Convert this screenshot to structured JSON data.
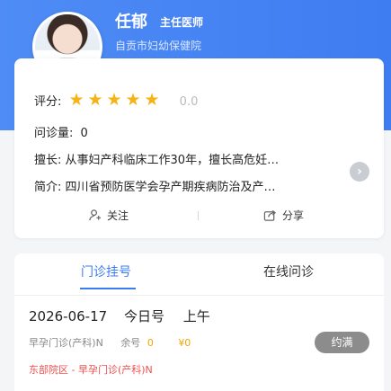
{
  "doctor": {
    "name": "任郁",
    "title": "主任医师",
    "hospital": "自贡市妇幼保健院"
  },
  "profile": {
    "rating_label": "评分:",
    "rating_stars": 5,
    "rating_value": "0.0",
    "consult_label": "问诊量:",
    "consult_value": "0",
    "specialty_label": "擅长:",
    "specialty_text": "从事妇产科临床工作30年，擅长高危妊…",
    "intro_label": "简介:",
    "intro_text": "四川省预防医学会孕产期疾病防治及产…",
    "follow_label": "关注",
    "share_label": "分享"
  },
  "tabs": [
    {
      "label": "门诊挂号",
      "active": true
    },
    {
      "label": "在线问诊",
      "active": false
    }
  ],
  "slot": {
    "date": "2026-06-17",
    "day_label": "今日号",
    "period": "上午",
    "clinic_type": "早孕门诊(产科)N",
    "remaining_label": "余号",
    "remaining_value": "0",
    "price": "¥0",
    "status_button": "约满",
    "location": "东部院区 - 早孕门诊(产科)N"
  },
  "colors": {
    "accent": "#3b7cf0",
    "star": "#f5b316",
    "warning": "#f05050",
    "orange": "#f0a500"
  }
}
